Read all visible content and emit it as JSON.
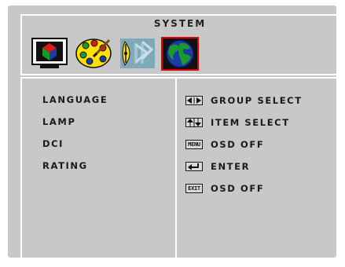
{
  "header": {
    "title": "SYSTEM"
  },
  "tabs": [
    {
      "icon": "picture-icon",
      "selected": false
    },
    {
      "icon": "color-palette-icon",
      "selected": false
    },
    {
      "icon": "adjust-icon",
      "selected": false
    },
    {
      "icon": "globe-icon",
      "selected": true
    }
  ],
  "menu": {
    "items": [
      {
        "label": "LANGUAGE"
      },
      {
        "label": "LAMP"
      },
      {
        "label": "DCI"
      },
      {
        "label": "RATING"
      }
    ]
  },
  "help": {
    "items": [
      {
        "key": "left-right-arrows-icon",
        "label": "GROUP SELECT"
      },
      {
        "key": "up-down-arrows-icon",
        "label": "ITEM SELECT"
      },
      {
        "key": "menu-key-icon",
        "badge": "MENU",
        "label": "OSD OFF"
      },
      {
        "key": "enter-key-icon",
        "label": "ENTER"
      },
      {
        "key": "exit-key-icon",
        "badge": "EXIT",
        "label": "OSD OFF"
      }
    ]
  },
  "colors": {
    "background": "#c8c8c8",
    "border": "#ffffff",
    "selection": "#e30000",
    "text": "#1a1a1a"
  }
}
